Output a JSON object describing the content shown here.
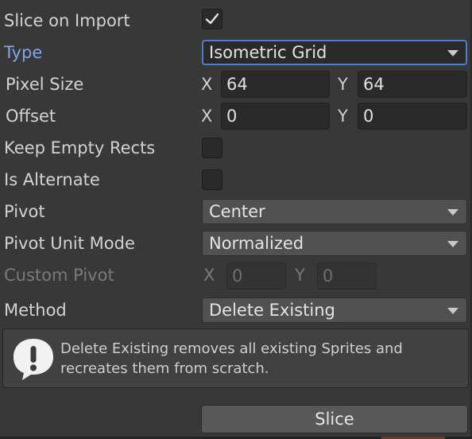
{
  "rows": {
    "slice_on_import": {
      "label": "Slice on Import",
      "checked": true
    },
    "type": {
      "label": "Type",
      "value": "Isometric Grid"
    },
    "pixel_size": {
      "label": "Pixel Size",
      "x_label": "X",
      "x": "64",
      "y_label": "Y",
      "y": "64"
    },
    "offset": {
      "label": "Offset",
      "x_label": "X",
      "x": "0",
      "y_label": "Y",
      "y": "0"
    },
    "keep_empty_rects": {
      "label": "Keep Empty Rects",
      "checked": false
    },
    "is_alternate": {
      "label": "Is Alternate",
      "checked": false
    },
    "pivot": {
      "label": "Pivot",
      "value": "Center"
    },
    "pivot_unit_mode": {
      "label": "Pivot Unit Mode",
      "value": "Normalized"
    },
    "custom_pivot": {
      "label": "Custom Pivot",
      "x_label": "X",
      "x": "0",
      "y_label": "Y",
      "y": "0"
    },
    "method": {
      "label": "Method",
      "value": "Delete Existing"
    }
  },
  "help": {
    "icon": "warning-exclamation-icon",
    "text": "Delete Existing removes all existing Sprites and recreates them from scratch."
  },
  "actions": {
    "slice_label": "Slice"
  },
  "colors": {
    "accent": "#4a7ed0",
    "active_label": "#7fa7e6",
    "background": "#383838"
  }
}
